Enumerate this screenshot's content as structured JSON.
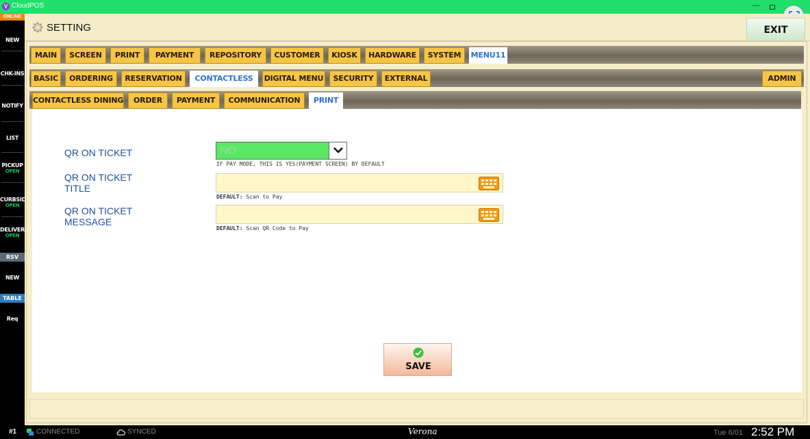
{
  "window": {
    "app_title": "CloudPOS",
    "app_icon_letter": "V"
  },
  "sidebar": {
    "online": "ONLINE",
    "items": [
      {
        "label": "NEW",
        "sub": ""
      },
      {
        "label": "CHK-INS",
        "sub": ""
      },
      {
        "label": "NOTIFY",
        "sub": ""
      },
      {
        "label": "LIST",
        "sub": ""
      },
      {
        "label": "PICKUP",
        "sub": "OPEN"
      },
      {
        "label": "CURBSID",
        "sub": "OPEN"
      },
      {
        "label": "DELIVER",
        "sub": "OPEN"
      },
      {
        "label": "RSV",
        "sub": ""
      },
      {
        "label": "NEW",
        "sub": ""
      },
      {
        "label": "TABLE",
        "sub": ""
      },
      {
        "label": "Req",
        "sub": ""
      }
    ]
  },
  "header": {
    "title": "SETTING",
    "exit_label": "EXIT"
  },
  "tabs_main": [
    "MAIN",
    "SCREEN",
    "PRINT",
    "PAYMENT",
    "REPOSITORY",
    "CUSTOMER",
    "KIOSK",
    "HARDWARE",
    "SYSTEM",
    "MENU11"
  ],
  "tabs_sub": [
    "BASIC",
    "ORDERING",
    "RESERVATION",
    "CONTACTLESS",
    "DIGITAL MENU",
    "SECURITY",
    "EXTERNAL"
  ],
  "admin_label": "ADMIN",
  "tabs_contactless": [
    "CONTACTLESS DINING",
    "ORDER",
    "PAYMENT",
    "COMMUNICATION",
    "PRINT"
  ],
  "form": {
    "qr_on_ticket": {
      "label": "QR ON TICKET",
      "value": "NO",
      "hint": "IF PAY MODE, THIS IS YES(PAYMENT SCREEN) BY DEFAULT"
    },
    "qr_title": {
      "label_line1": "QR ON TICKET",
      "label_line2": "TITLE",
      "value": "",
      "hint_key": "DEFAULT:",
      "hint_val": " Scan to Pay"
    },
    "qr_message": {
      "label_line1": "QR ON TICKET",
      "label_line2": "MESSAGE",
      "value": "",
      "hint_key": "DEFAULT:",
      "hint_val": " Scan QR Code to Pay"
    },
    "save_label": "SAVE"
  },
  "status": {
    "station": "#1",
    "connected": "CONNECTED",
    "synced": "SYNCED",
    "location": "Verona",
    "date": "Tue 6/01",
    "time": "2:52 PM"
  },
  "colors": {
    "titlebar": "#20df6a",
    "tab": "#f6c545",
    "tab_active_text": "#2b6fcf",
    "dropdown_bg": "#58e863",
    "field_bg": "#fff7c9"
  }
}
